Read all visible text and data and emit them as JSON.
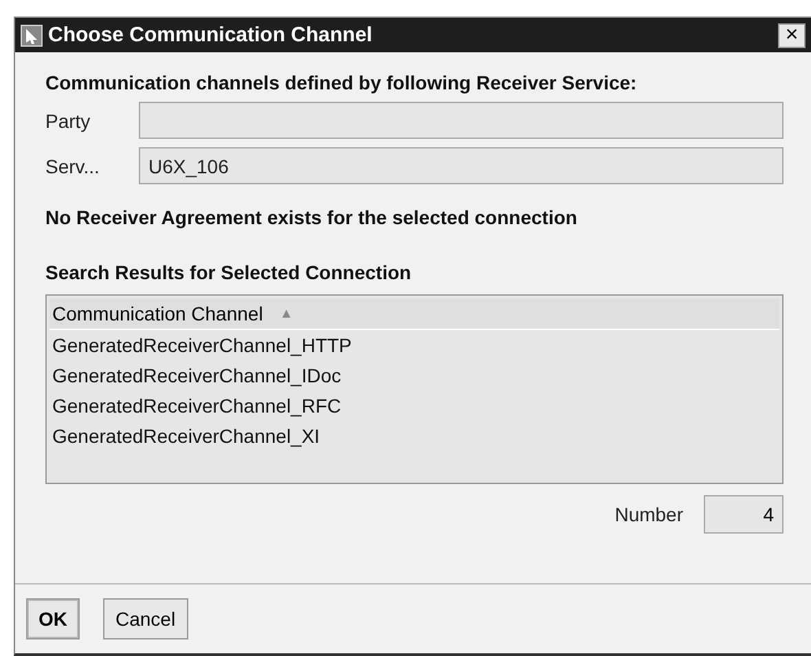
{
  "window": {
    "title": "Choose Communication Channel",
    "close": "×"
  },
  "section_heading": "Communication channels defined by following Receiver Service:",
  "fields": [
    {
      "label": "Party"
    },
    {
      "label": "Serv...",
      "value": "U6X_106"
    }
  ],
  "message": "No Receiver Agreement exists for the selected connection",
  "results_heading": "Search Results for Selected Connection",
  "table": {
    "columns": [
      {
        "label": "Communication Channel",
        "sort_indicator": "▲"
      }
    ],
    "rows": [
      "GeneratedReceiverChannel_HTTP",
      "GeneratedReceiverChannel_IDoc",
      "GeneratedReceiverChannel_RFC",
      "GeneratedReceiverChannel_XI"
    ]
  },
  "count": {
    "label": "Number",
    "value": "4"
  },
  "buttons": [
    {
      "label": "OK",
      "default": true
    },
    {
      "label": "Cancel",
      "default": false
    }
  ]
}
